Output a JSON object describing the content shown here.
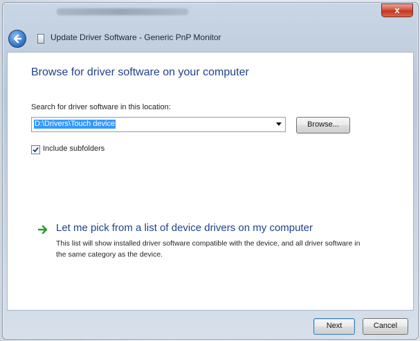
{
  "window": {
    "close_label": "x",
    "title": "Update Driver Software - Generic PnP Monitor"
  },
  "page": {
    "heading": "Browse for driver software on your computer",
    "search_label": "Search for driver software in this location:",
    "path_value": "D:\\Drivers\\Touch device",
    "browse_label": "Browse...",
    "include_subfolders_label": "Include subfolders",
    "include_subfolders_checked": true,
    "pick_title": "Let me pick from a list of device drivers on my computer",
    "pick_description": "This list will show installed driver software compatible with the device, and all driver software in the same category as the device."
  },
  "footer": {
    "next_label": "Next",
    "cancel_label": "Cancel"
  },
  "colors": {
    "heading_blue": "#1f3f8c",
    "selection_blue": "#3399ff",
    "arrow_green": "#2e9a2e"
  },
  "icons": {
    "back": "back-arrow-icon",
    "monitor": "monitor-icon",
    "arrow": "green-arrow-icon",
    "check": "checkmark-icon"
  }
}
